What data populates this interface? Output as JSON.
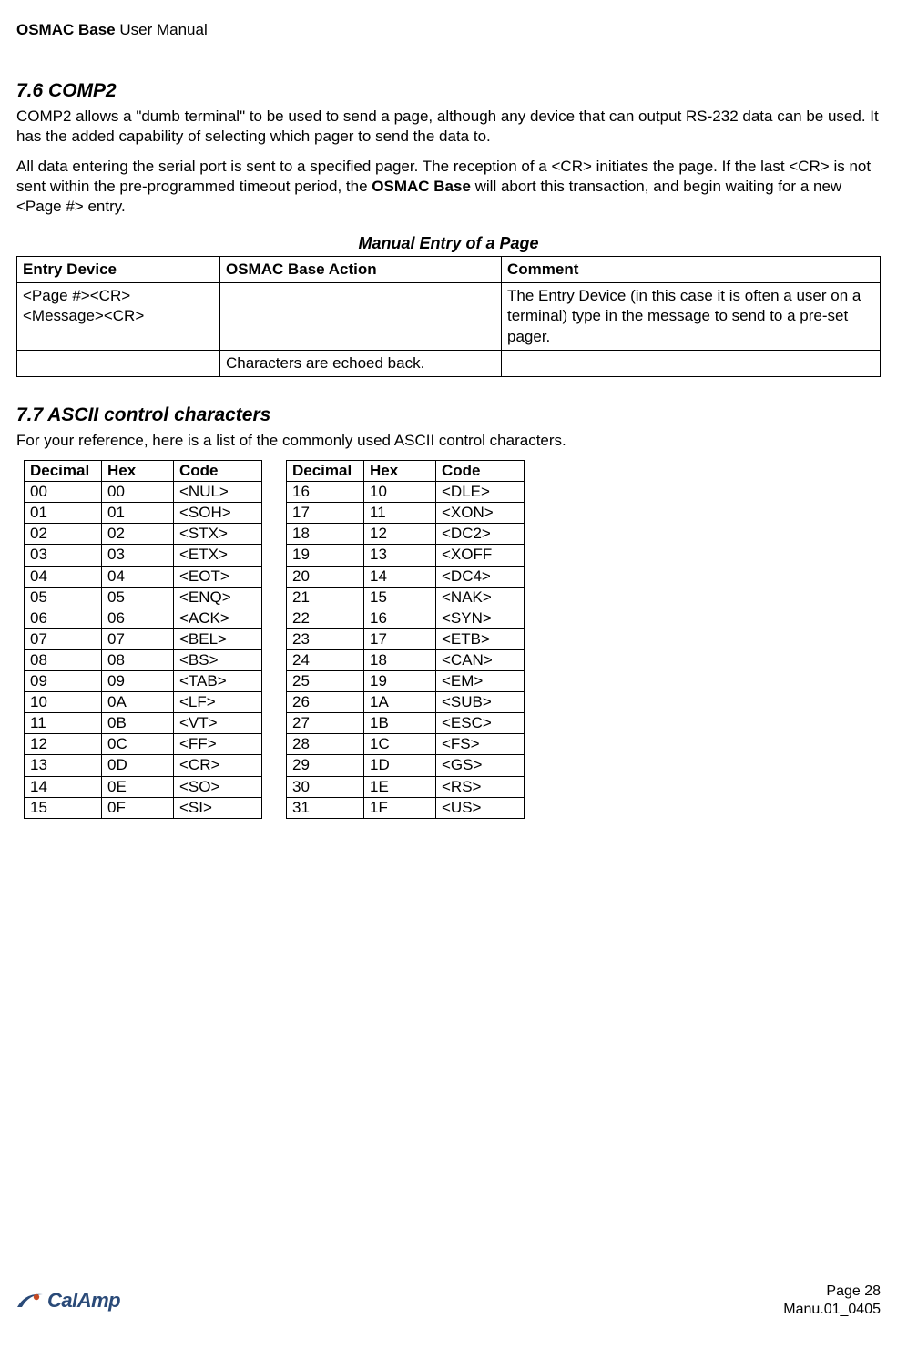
{
  "header": {
    "bold": "OSMAC Base",
    "rest": " User Manual"
  },
  "section76": {
    "heading": "7.6    COMP2",
    "p1": "COMP2 allows a \"dumb terminal\" to be used to send a page, although any device that can output RS-232 data can be used.  It has the added capability of selecting which pager to send the data to.",
    "p2_a": "All data entering the serial port is sent to a specified pager.  The reception of a <CR> initiates the page.  If the last <CR> is not sent within the pre-programmed timeout period, the ",
    "p2_bold": "OSMAC Base",
    "p2_b": " will abort this transaction, and begin waiting for a new <Page #> entry."
  },
  "entry_table": {
    "caption": "Manual Entry of a Page",
    "headers": {
      "c1": "Entry Device",
      "c2": "OSMAC Base Action",
      "c3": "Comment"
    },
    "row1": {
      "c1": "<Page #><CR> <Message><CR>",
      "c2": "",
      "c3": "The Entry Device (in this case it is often a user on a terminal) type in the message to send to a pre-set pager."
    },
    "row2": {
      "c1": "",
      "c2": "Characters are echoed back.",
      "c3": ""
    }
  },
  "section77": {
    "heading": "7.7    ASCII control characters",
    "p1": "For your reference, here is a list of the commonly used ASCII control characters."
  },
  "ascii_headers": {
    "dec": "Decimal",
    "hex": "Hex",
    "code": "Code"
  },
  "ascii_left": [
    {
      "dec": "00",
      "hex": "00",
      "code": "<NUL>"
    },
    {
      "dec": "01",
      "hex": "01",
      "code": "<SOH>"
    },
    {
      "dec": "02",
      "hex": "02",
      "code": "<STX>"
    },
    {
      "dec": "03",
      "hex": "03",
      "code": "<ETX>"
    },
    {
      "dec": "04",
      "hex": "04",
      "code": "<EOT>"
    },
    {
      "dec": "05",
      "hex": "05",
      "code": "<ENQ>"
    },
    {
      "dec": "06",
      "hex": "06",
      "code": "<ACK>"
    },
    {
      "dec": "07",
      "hex": "07",
      "code": "<BEL>"
    },
    {
      "dec": "08",
      "hex": "08",
      "code": "<BS>"
    },
    {
      "dec": "09",
      "hex": "09",
      "code": "<TAB>"
    },
    {
      "dec": "10",
      "hex": "0A",
      "code": "<LF>"
    },
    {
      "dec": "11",
      "hex": "0B",
      "code": "<VT>"
    },
    {
      "dec": "12",
      "hex": "0C",
      "code": "<FF>"
    },
    {
      "dec": "13",
      "hex": "0D",
      "code": "<CR>"
    },
    {
      "dec": "14",
      "hex": "0E",
      "code": "<SO>"
    },
    {
      "dec": "15",
      "hex": "0F",
      "code": "<SI>"
    }
  ],
  "ascii_right": [
    {
      "dec": "16",
      "hex": "10",
      "code": "<DLE>"
    },
    {
      "dec": "17",
      "hex": "11",
      "code": "<XON>"
    },
    {
      "dec": "18",
      "hex": "12",
      "code": "<DC2>"
    },
    {
      "dec": "19",
      "hex": "13",
      "code": "<XOFF"
    },
    {
      "dec": "20",
      "hex": "14",
      "code": "<DC4>"
    },
    {
      "dec": "21",
      "hex": "15",
      "code": "<NAK>"
    },
    {
      "dec": "22",
      "hex": "16",
      "code": "<SYN>"
    },
    {
      "dec": "23",
      "hex": "17",
      "code": "<ETB>"
    },
    {
      "dec": "24",
      "hex": "18",
      "code": "<CAN>"
    },
    {
      "dec": "25",
      "hex": "19",
      "code": "<EM>"
    },
    {
      "dec": "26",
      "hex": "1A",
      "code": "<SUB>"
    },
    {
      "dec": "27",
      "hex": "1B",
      "code": "<ESC>"
    },
    {
      "dec": "28",
      "hex": "1C",
      "code": "<FS>"
    },
    {
      "dec": "29",
      "hex": "1D",
      "code": "<GS>"
    },
    {
      "dec": "30",
      "hex": "1E",
      "code": "<RS>"
    },
    {
      "dec": "31",
      "hex": "1F",
      "code": "<US>"
    }
  ],
  "footer": {
    "logo_text": "CalAmp",
    "page_line": "Page 28",
    "manu_line": "Manu.01_0405"
  }
}
